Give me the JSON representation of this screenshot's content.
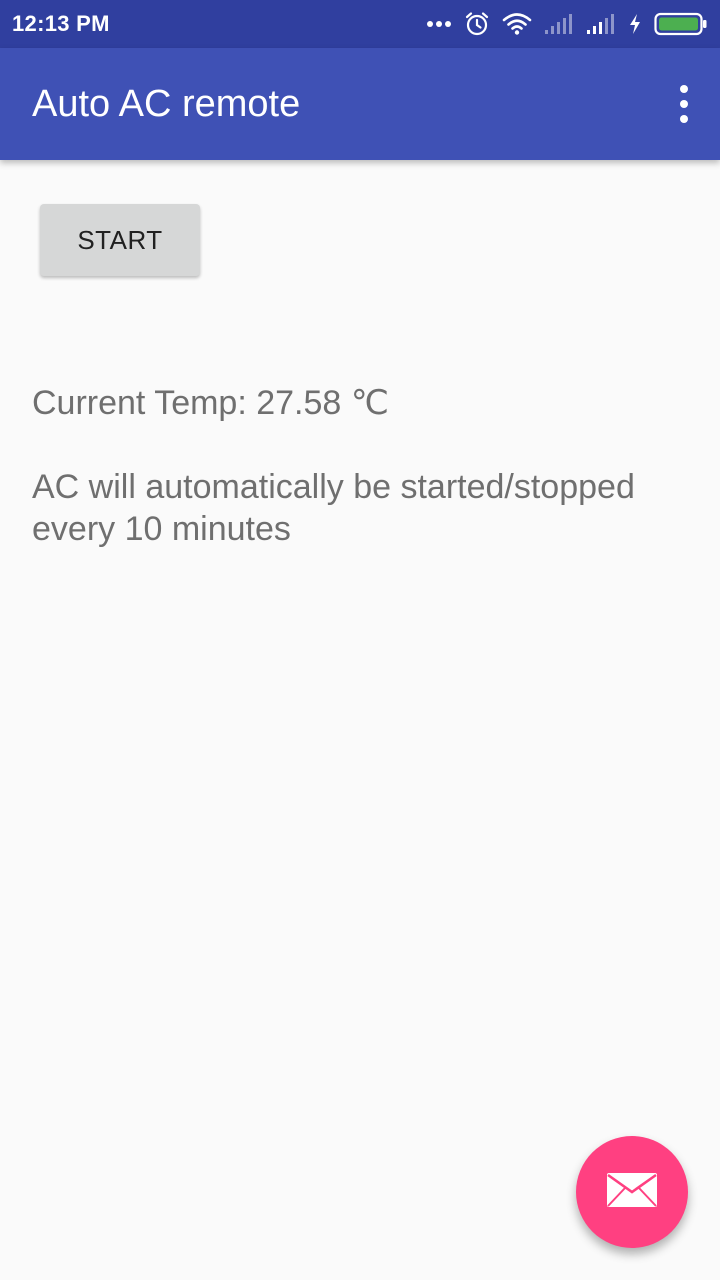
{
  "status_bar": {
    "time": "12:13 PM",
    "icons": [
      "more-dots-icon",
      "alarm-icon",
      "wifi-icon",
      "signal-icon",
      "signal-icon",
      "charging-icon",
      "battery-icon"
    ]
  },
  "app_bar": {
    "title": "Auto AC remote",
    "menu_icon": "overflow-menu-icon",
    "color": "#3f51b5"
  },
  "main": {
    "start_button_label": "START",
    "current_temp": "Current Temp: 27.58 ℃",
    "info": "AC will automatically be started/stopped every 10 minutes"
  },
  "fab": {
    "icon": "mail-icon",
    "color": "#ff4081"
  },
  "colors": {
    "status_bar": "#303f9f",
    "battery": "#4caf50"
  }
}
